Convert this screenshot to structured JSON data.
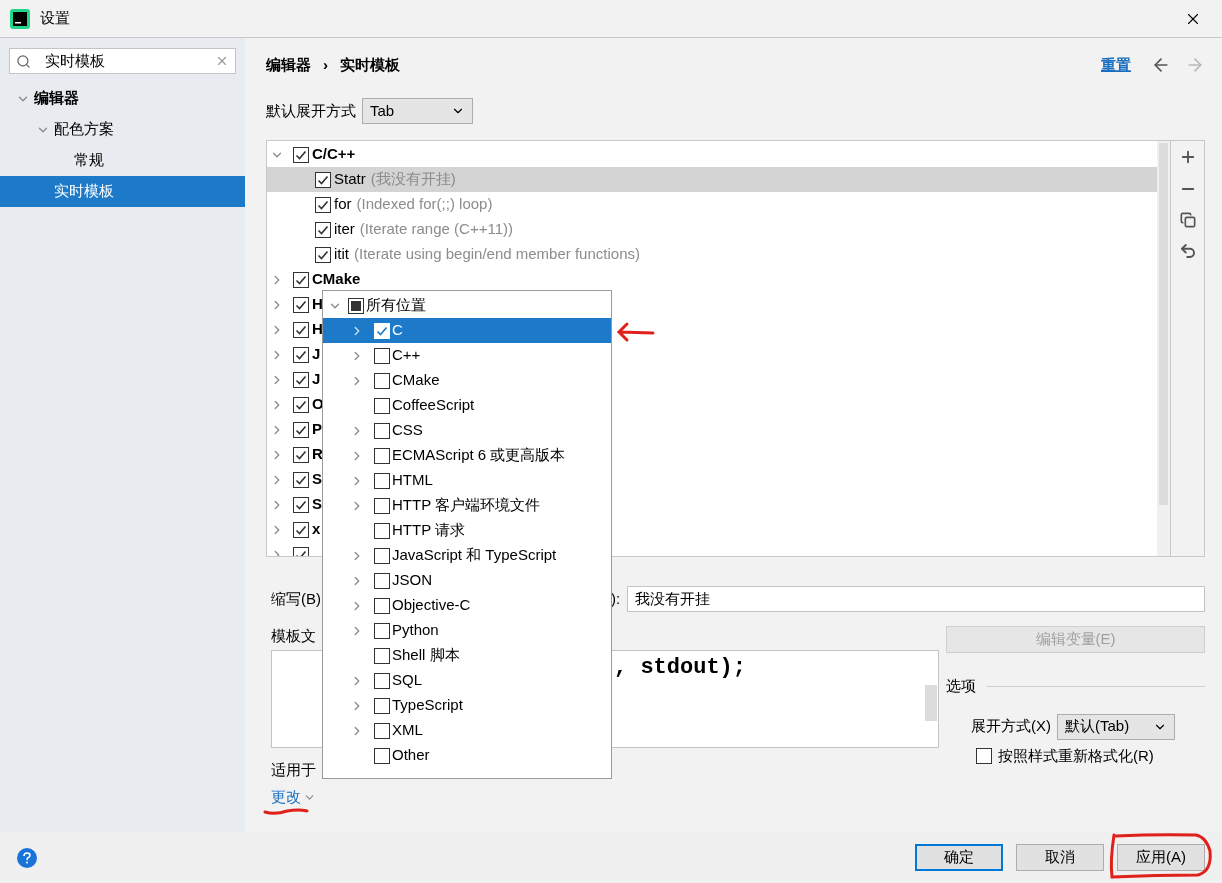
{
  "window": {
    "title": "设置"
  },
  "sidebar": {
    "search": {
      "value": "实时模板"
    },
    "items": [
      {
        "label": "编辑器",
        "expanded": true,
        "selected": false,
        "children": [
          {
            "label": "配色方案",
            "expanded": true,
            "selected": false,
            "children": [
              {
                "label": "常规",
                "selected": false
              }
            ]
          },
          {
            "label": "实时模板",
            "selected": true
          }
        ]
      }
    ]
  },
  "breadcrumb": {
    "items": [
      "编辑器",
      "实时模板"
    ],
    "separator": "›"
  },
  "reset_link": "重置",
  "expand_with": {
    "label": "默认展开方式",
    "value": "Tab"
  },
  "template_groups": [
    {
      "name": "C/C++",
      "checked": true,
      "expanded": true,
      "templates": [
        {
          "abbr": "Statr",
          "description": "(我没有开挂)",
          "checked": true,
          "selected": true
        },
        {
          "abbr": "for",
          "description": "(Indexed for(;;) loop)",
          "checked": true,
          "selected": false
        },
        {
          "abbr": "iter",
          "description": "(Iterate range (C++11))",
          "checked": true,
          "selected": false
        },
        {
          "abbr": "itit",
          "description": "(Iterate using begin/end member functions)",
          "checked": true,
          "selected": false
        }
      ]
    },
    {
      "name": "CMake",
      "checked": true,
      "expanded": false
    },
    {
      "name": "H",
      "checked": true,
      "expanded": false
    },
    {
      "name": "H",
      "checked": true,
      "expanded": false
    },
    {
      "name": "J",
      "checked": true,
      "expanded": false
    },
    {
      "name": "J",
      "checked": true,
      "expanded": false
    },
    {
      "name": "O",
      "checked": true,
      "expanded": false
    },
    {
      "name": "P",
      "checked": true,
      "expanded": false
    },
    {
      "name": "R",
      "checked": true,
      "expanded": false
    },
    {
      "name": "S",
      "checked": true,
      "expanded": false
    },
    {
      "name": "S",
      "checked": true,
      "expanded": false
    },
    {
      "name": "x",
      "checked": true,
      "expanded": false
    },
    {
      "checked": true,
      "expanded": false
    }
  ],
  "abbreviation": {
    "label": "缩写(B)",
    "description_label": "):",
    "description_value": "我没有开挂"
  },
  "template_text": {
    "label": "模板文",
    "code": ", stdout);"
  },
  "edit_variables": {
    "label": "编辑变量(E)",
    "disabled": true
  },
  "options": {
    "title": "选项",
    "expand_with": {
      "label": "展开方式(X)",
      "value": "默认(Tab)"
    },
    "reformat": {
      "label": "按照样式重新格式化(R)",
      "checked": false
    }
  },
  "applicable": {
    "label": "适用于",
    "change_link": "更改"
  },
  "context_popup": {
    "root": {
      "label": "所有位置",
      "indeterminate": true,
      "expanded": true
    },
    "items": [
      {
        "label": "C",
        "checked": true,
        "selected": true,
        "expandable": true
      },
      {
        "label": "C++",
        "checked": false,
        "selected": false,
        "expandable": true
      },
      {
        "label": "CMake",
        "checked": false,
        "selected": false,
        "expandable": true
      },
      {
        "label": "CoffeeScript",
        "checked": false,
        "selected": false,
        "expandable": false
      },
      {
        "label": "CSS",
        "checked": false,
        "selected": false,
        "expandable": true
      },
      {
        "label": "ECMAScript 6 或更高版本",
        "checked": false,
        "selected": false,
        "expandable": true
      },
      {
        "label": "HTML",
        "checked": false,
        "selected": false,
        "expandable": true
      },
      {
        "label": "HTTP 客户端环境文件",
        "checked": false,
        "selected": false,
        "expandable": true
      },
      {
        "label": "HTTP 请求",
        "checked": false,
        "selected": false,
        "expandable": false
      },
      {
        "label": "JavaScript 和 TypeScript",
        "checked": false,
        "selected": false,
        "expandable": true
      },
      {
        "label": "JSON",
        "checked": false,
        "selected": false,
        "expandable": true
      },
      {
        "label": "Objective-C",
        "checked": false,
        "selected": false,
        "expandable": true
      },
      {
        "label": "Python",
        "checked": false,
        "selected": false,
        "expandable": true
      },
      {
        "label": "Shell 脚本",
        "checked": false,
        "selected": false,
        "expandable": false
      },
      {
        "label": "SQL",
        "checked": false,
        "selected": false,
        "expandable": true
      },
      {
        "label": "TypeScript",
        "checked": false,
        "selected": false,
        "expandable": true
      },
      {
        "label": "XML",
        "checked": false,
        "selected": false,
        "expandable": true
      },
      {
        "label": "Other",
        "checked": false,
        "selected": false,
        "expandable": false
      }
    ]
  },
  "buttons": [
    {
      "label": "确定",
      "kind": "primary"
    },
    {
      "label": "取消",
      "kind": "normal"
    },
    {
      "label": "应用(A)",
      "kind": "normal"
    }
  ]
}
